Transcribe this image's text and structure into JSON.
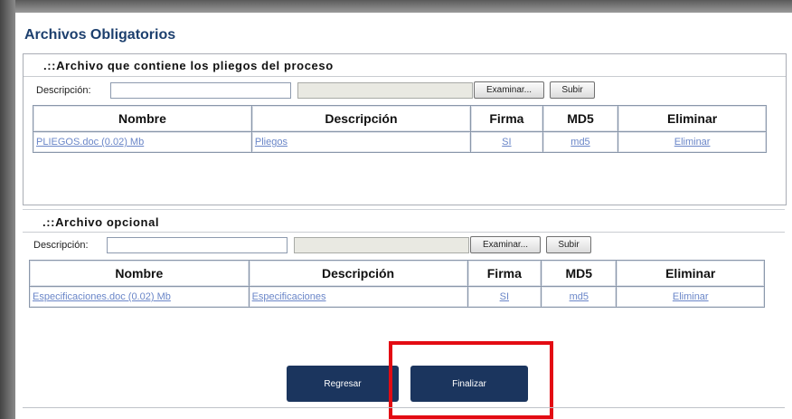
{
  "page": {
    "title": "Archivos Obligatorios"
  },
  "sections": [
    {
      "heading": ".::Archivo que contiene los pliegos del proceso",
      "desc_label": "Descripción:",
      "desc_value": "",
      "browse_label": "Examinar...",
      "upload_label": "Subir",
      "columns": [
        "Nombre",
        "Descripción",
        "Firma",
        "MD5",
        "Eliminar"
      ],
      "rows": [
        {
          "nombre": "PLIEGOS.doc (0.02) Mb",
          "descripcion": "Pliegos",
          "firma": "SI",
          "md5": "md5",
          "eliminar": "Eliminar"
        }
      ]
    },
    {
      "heading": ".::Archivo opcional",
      "desc_label": "Descripción:",
      "desc_value": "",
      "browse_label": "Examinar...",
      "upload_label": "Subir",
      "columns": [
        "Nombre",
        "Descripción",
        "Firma",
        "MD5",
        "Eliminar"
      ],
      "rows": [
        {
          "nombre": "Especificaciones.doc (0.02) Mb",
          "descripcion": "Especificaciones",
          "firma": "SI",
          "md5": "md5",
          "eliminar": "Eliminar"
        }
      ]
    }
  ],
  "footer": {
    "back_label": "Regresar",
    "finish_label": "Finalizar"
  },
  "colors": {
    "nav_button": "#1b355e",
    "highlight": "#e30b13",
    "title": "#1c3f6e",
    "link": "#6a86c8"
  }
}
